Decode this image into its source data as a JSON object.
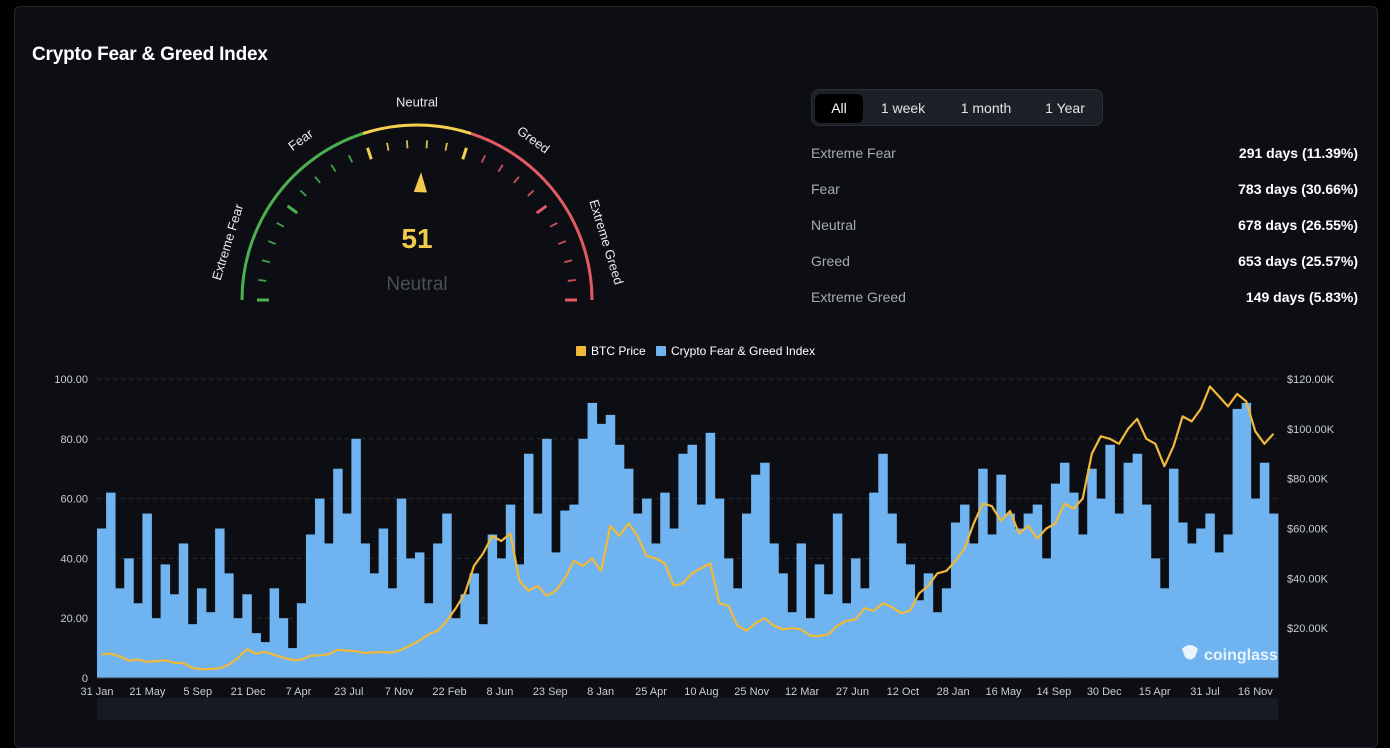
{
  "page": {
    "title": "Crypto Fear & Greed Index"
  },
  "gauge": {
    "value": 51,
    "classification": "Neutral",
    "max": 100,
    "zone_labels": [
      "Extreme Fear",
      "Fear",
      "Neutral",
      "Greed",
      "Extreme Greed"
    ],
    "colors": {
      "fear": "#4caf50",
      "neutral": "#f3d14f",
      "greed": "#e25a62",
      "value": "#f3c94c"
    }
  },
  "filters": {
    "options": [
      "All",
      "1 week",
      "1 month",
      "1 Year"
    ],
    "selected": "All"
  },
  "stats": [
    {
      "label": "Extreme Fear",
      "value": "291 days (11.39%)"
    },
    {
      "label": "Fear",
      "value": "783 days (30.66%)"
    },
    {
      "label": "Neutral",
      "value": "678 days (26.55%)"
    },
    {
      "label": "Greed",
      "value": "653 days (25.57%)"
    },
    {
      "label": "Extreme Greed",
      "value": "149 days (5.83%)"
    }
  ],
  "watermark": "coinglass",
  "chart_data": {
    "type": "bar",
    "x_ticks": [
      "31 Jan",
      "21 May",
      "5 Sep",
      "21 Dec",
      "7 Apr",
      "23 Jul",
      "7 Nov",
      "22 Feb",
      "8 Jun",
      "23 Sep",
      "8 Jan",
      "25 Apr",
      "10 Aug",
      "25 Nov",
      "12 Mar",
      "27 Jun",
      "12 Oct",
      "28 Jan",
      "16 May",
      "14 Sep",
      "30 Dec",
      "15 Apr",
      "31 Jul",
      "16 Nov"
    ],
    "y_left_ticks": [
      "0",
      "20.00",
      "40.00",
      "60.00",
      "80.00",
      "100.00"
    ],
    "y_left_range": [
      0,
      100
    ],
    "y_right_ticks": [
      "$20.00K",
      "$40.00K",
      "$60.00K",
      "$80.00K",
      "$100.00K",
      "$120.00K"
    ],
    "y_right_range": [
      0,
      120000
    ],
    "grid": true,
    "legend_position": "top-center",
    "series": [
      {
        "name": "Crypto Fear & Greed Index",
        "type": "bar",
        "color": "#6fb4f0",
        "values": [
          50,
          62,
          30,
          40,
          25,
          55,
          20,
          38,
          28,
          45,
          18,
          30,
          22,
          50,
          35,
          20,
          28,
          15,
          12,
          30,
          20,
          10,
          25,
          48,
          60,
          45,
          70,
          55,
          80,
          45,
          35,
          50,
          30,
          60,
          40,
          42,
          25,
          45,
          55,
          20,
          28,
          35,
          18,
          48,
          40,
          58,
          38,
          75,
          55,
          80,
          42,
          56,
          58,
          80,
          92,
          85,
          88,
          78,
          70,
          55,
          60,
          45,
          62,
          50,
          75,
          78,
          58,
          82,
          60,
          40,
          30,
          55,
          68,
          72,
          45,
          35,
          22,
          45,
          20,
          38,
          28,
          55,
          25,
          40,
          30,
          62,
          75,
          55,
          45,
          38,
          26,
          35,
          22,
          30,
          52,
          58,
          45,
          70,
          48,
          68,
          55,
          50,
          55,
          58,
          40,
          65,
          72,
          62,
          48,
          70,
          60,
          78,
          55,
          72,
          75,
          58,
          40,
          30,
          70,
          52,
          45,
          50,
          55,
          42,
          48,
          90,
          92,
          60,
          72,
          55
        ]
      },
      {
        "name": "BTC Price",
        "type": "line",
        "color": "#f0b93a",
        "values": [
          9500,
          9800,
          8700,
          7000,
          7400,
          6500,
          6800,
          7100,
          6100,
          6000,
          4000,
          3500,
          3600,
          3900,
          5300,
          8000,
          11500,
          9800,
          10500,
          9300,
          8200,
          7200,
          7400,
          8900,
          9100,
          9500,
          11300,
          11000,
          10700,
          10000,
          10300,
          10400,
          10200,
          11300,
          13100,
          15000,
          17500,
          19000,
          23000,
          28000,
          34000,
          45000,
          50000,
          57000,
          55000,
          58000,
          39000,
          35000,
          37000,
          33000,
          35000,
          40000,
          47000,
          45000,
          48000,
          43000,
          61000,
          57000,
          62000,
          57000,
          49000,
          48000,
          46000,
          37000,
          38000,
          42000,
          44000,
          46000,
          30000,
          29000,
          21000,
          19000,
          22000,
          24000,
          21000,
          19500,
          20000,
          19500,
          17000,
          16800,
          17500,
          21000,
          23000,
          23500,
          28000,
          27000,
          30000,
          28500,
          26000,
          27000,
          34000,
          37000,
          42000,
          43000,
          47000,
          52000,
          62000,
          70000,
          69000,
          63000,
          67000,
          58000,
          61000,
          56000,
          60000,
          62000,
          70000,
          68000,
          72000,
          90000,
          97000,
          96000,
          94000,
          100000,
          104000,
          96000,
          94000,
          85000,
          93000,
          105000,
          103000,
          108000,
          117000,
          113000,
          109000,
          114000,
          111000,
          99000,
          94000,
          98000
        ]
      }
    ]
  }
}
